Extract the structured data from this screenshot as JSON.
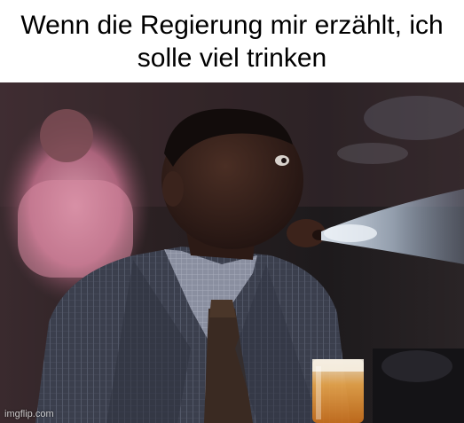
{
  "meme": {
    "caption": "Wenn die Regierung mir erzählt, ich solle viel trinken",
    "watermark": "imgflip.com"
  },
  "photo": {
    "description_icon": "spit-take-photo"
  }
}
